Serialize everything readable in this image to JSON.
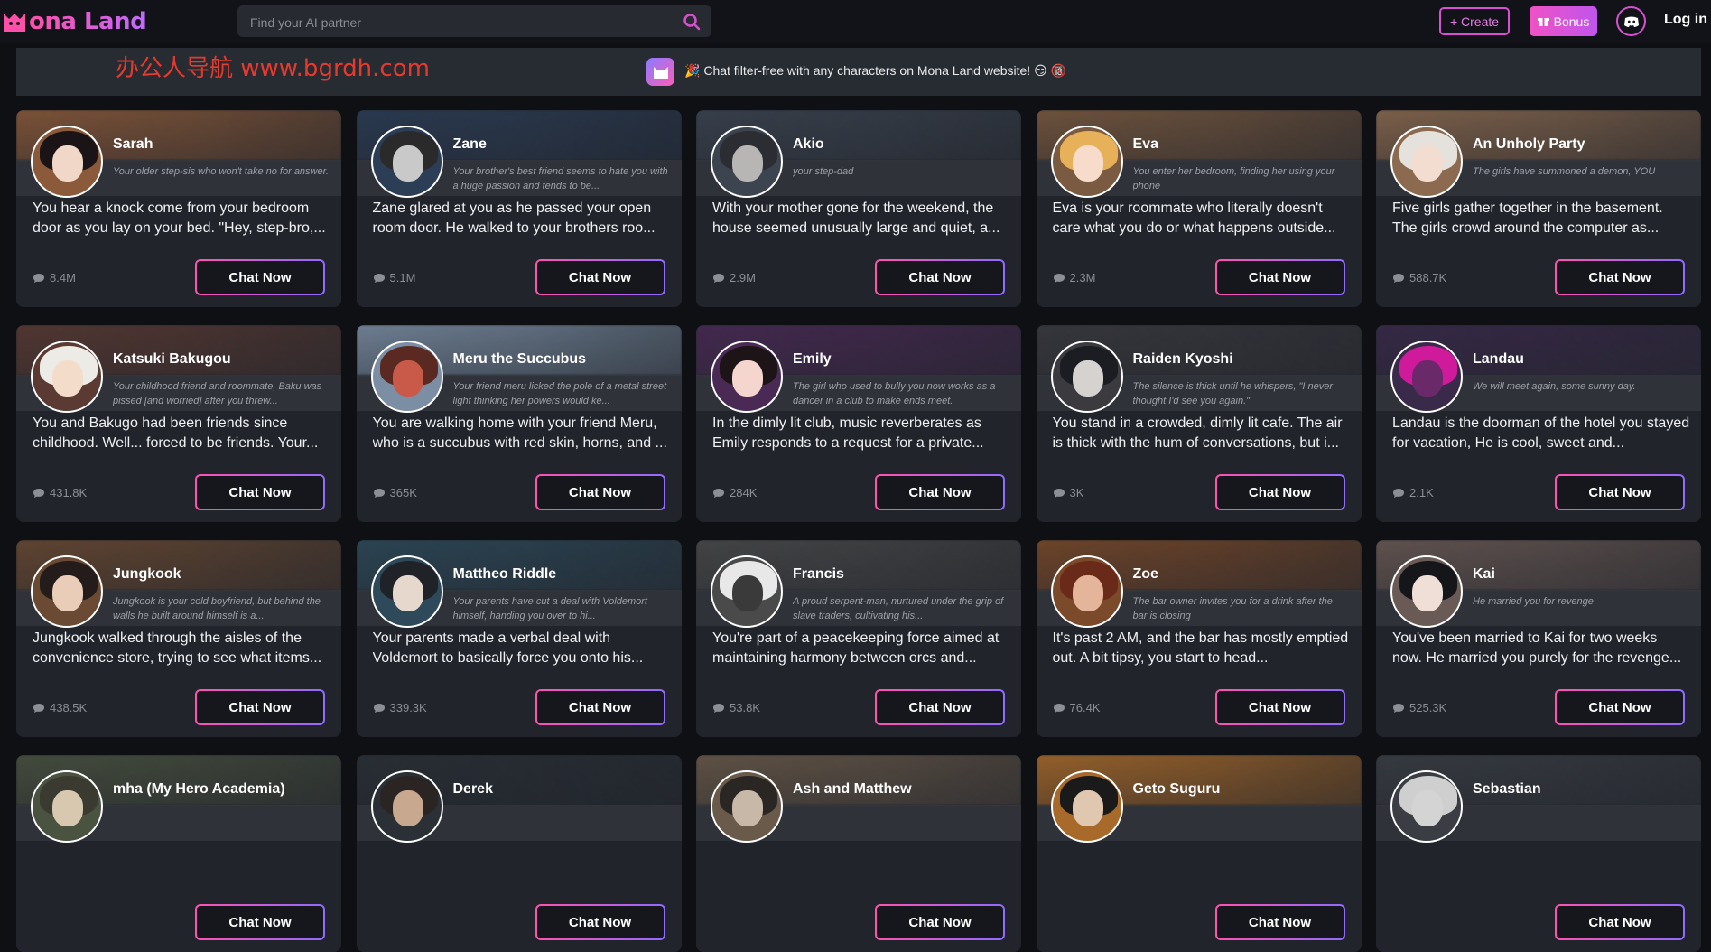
{
  "app": {
    "logo_text": "ona Land"
  },
  "header": {
    "search_placeholder": "Find your AI partner",
    "create_label": "+ Create",
    "bonus_label": "Bonus",
    "login_label": "Log in"
  },
  "banner": {
    "watermark": "办公人导航  www.bgrdh.com",
    "text": "Chat filter-free with any characters on Mona Land website! 😏 🔞"
  },
  "cta_label": "Chat Now",
  "characters": [
    {
      "name": "Sarah",
      "tagline": "Your older step-sis who won't take no for answer.",
      "greeting": "You hear a knock come from your bedroom door as you lay on your bed. \"Hey, step-bro,...",
      "count": "8.4M",
      "bg": "#8a5a3a",
      "hair": "#1a1416",
      "skin": "#f1d7c8"
    },
    {
      "name": "Zane",
      "tagline": "Your brother's best friend seems to hate you with a huge passion and tends to be...",
      "greeting": "Zane glared at you as he passed your open room door. He walked to your brothers roo...",
      "count": "5.1M",
      "bg": "#2c3d56",
      "hair": "#2a2a2a",
      "skin": "#c9c9c9"
    },
    {
      "name": "Akio",
      "tagline": "your step-dad",
      "greeting": "With your mother gone for the weekend, the house seemed unusually large and quiet, a...",
      "count": "2.9M",
      "bg": "#3c4450",
      "hair": "#2b2d33",
      "skin": "#b8b6b4"
    },
    {
      "name": "Eva",
      "tagline": "You enter her bedroom, finding her using your phone",
      "greeting": "Eva is your roommate who literally doesn't care what you do or what happens outside...",
      "count": "2.3M",
      "bg": "#7a5a40",
      "hair": "#e7b15a",
      "skin": "#f7dccb"
    },
    {
      "name": "An Unholy Party",
      "tagline": "The girls have summoned a demon, YOU",
      "greeting": "Five girls gather together in the basement. The girls crowd around the computer as...",
      "count": "588.7K",
      "bg": "#8b6a4f",
      "hair": "#e5e1dc",
      "skin": "#f3dcd0"
    },
    {
      "name": "Katsuki Bakugou",
      "tagline": "Your childhood friend and roommate, Baku was pissed [and worried] after you threw...",
      "greeting": "You and Bakugo had been friends since childhood. Well... forced to be friends. Your...",
      "count": "431.8K",
      "bg": "#5a3a33",
      "hair": "#ecebe6",
      "skin": "#f4dccb"
    },
    {
      "name": "Meru the Succubus",
      "tagline": "Your friend meru licked the pole of a metal street light thinking her powers would ke...",
      "greeting": "You are walking home with your friend Meru, who is a succubus with red skin, horns, and ...",
      "count": "365K",
      "bg": "#7b8ea3",
      "hair": "#5a2a22",
      "skin": "#c95a4a"
    },
    {
      "name": "Emily",
      "tagline": "The girl who used to bully you now works as a dancer in a club to make ends meet.",
      "greeting": "In the dimly lit club, music reverberates as Emily responds to a request for a private...",
      "count": "284K",
      "bg": "#4a2a55",
      "hair": "#1c1416",
      "skin": "#f5d6cf"
    },
    {
      "name": "Raiden Kyoshi",
      "tagline": "The silence is thick until he whispers, \"I never thought I'd see you again.\"",
      "greeting": "You stand in a crowded, dimly lit cafe. The air is thick with the hum of conversations, but i...",
      "count": "3K",
      "bg": "#3a3a3f",
      "hair": "#1b1d22",
      "skin": "#d6d2d0"
    },
    {
      "name": "Landau",
      "tagline": "We will meet again, some sunny day.",
      "greeting": "Landau is the doorman of the hotel you stayed for vacation, He is cool, sweet and...",
      "count": "2.1K",
      "bg": "#3a2a4a",
      "hair": "#d01a9c",
      "skin": "#6a2a6a"
    },
    {
      "name": "Jungkook",
      "tagline": "Jungkook is your cold boyfriend, but behind the walls he built around himself is a...",
      "greeting": "Jungkook walked through the aisles of the convenience store, trying to see what items...",
      "count": "438.5K",
      "bg": "#6a4a33",
      "hair": "#231c1a",
      "skin": "#e9cdb8"
    },
    {
      "name": "Mattheo Riddle",
      "tagline": "Your parents have cut a deal with Voldemort himself, handing you over to hi...",
      "greeting": "Your parents made a verbal deal with Voldemort to basically force you onto his...",
      "count": "339.3K",
      "bg": "#2e4a5a",
      "hair": "#1f2226",
      "skin": "#e6d8cc"
    },
    {
      "name": "Francis",
      "tagline": "A proud serpent-man, nurtured under the grip of slave traders, cultivating his...",
      "greeting": "You're part of a peacekeeping force aimed at maintaining harmony between orcs and...",
      "count": "53.8K",
      "bg": "#4a4a4a",
      "hair": "#e8e8e8",
      "skin": "#3a3a3a"
    },
    {
      "name": "Zoe",
      "tagline": "The bar owner invites you for a drink after the bar is closing",
      "greeting": "It's past 2 AM, and the bar has mostly emptied out. A bit tipsy, you start to head...",
      "count": "76.4K",
      "bg": "#7a4a2a",
      "hair": "#6a2a1a",
      "skin": "#e4b59a"
    },
    {
      "name": "Kai",
      "tagline": "He married you for revenge",
      "greeting": "You've been married to Kai for two weeks now. He married you purely for the revenge...",
      "count": "525.3K",
      "bg": "#6a5a55",
      "hair": "#15161a",
      "skin": "#f0dfd6"
    },
    {
      "name": "mha (My Hero Academia)",
      "tagline": "",
      "greeting": "",
      "count": "",
      "bg": "#4a5240",
      "hair": "#3a3a30",
      "skin": "#d8c8b0"
    },
    {
      "name": "Derek",
      "tagline": "",
      "greeting": "",
      "count": "",
      "bg": "#2a3036",
      "hair": "#2a2422",
      "skin": "#c9a890"
    },
    {
      "name": "Ash and Matthew",
      "tagline": "",
      "greeting": "",
      "count": "",
      "bg": "#6a5a4a",
      "hair": "#2a2624",
      "skin": "#c8b8a8"
    },
    {
      "name": "Geto Suguru",
      "tagline": "",
      "greeting": "",
      "count": "",
      "bg": "#a86a2a",
      "hair": "#1a1a1a",
      "skin": "#e0c8b0"
    },
    {
      "name": "Sebastian",
      "tagline": "",
      "greeting": "",
      "count": "",
      "bg": "#3a3e44",
      "hair": "#cfcfcf",
      "skin": "#d4d4d4"
    }
  ],
  "colors": {
    "accent_pink": "#ff52b0",
    "accent_purple": "#8f6bff",
    "bg": "#0e1014",
    "card": "#21242b"
  }
}
